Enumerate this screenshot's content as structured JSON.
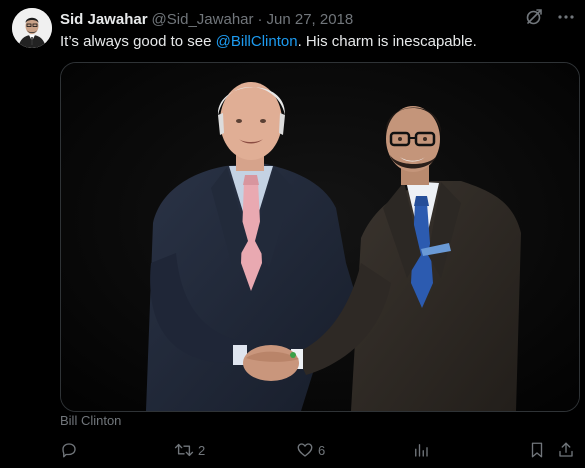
{
  "tweet": {
    "author_name": "Sid Jawahar",
    "author_handle": "@Sid_Jawahar",
    "separator": "·",
    "date": "Jun 27, 2018",
    "text_before": "It’s always good to see ",
    "mention": "@BillClinton",
    "text_after": ". His charm is inescapable.",
    "media_caption": "Bill Clinton"
  },
  "actions": {
    "replies": "",
    "retweets": "2",
    "likes": "6",
    "views": ""
  },
  "icons": {
    "reply": "reply-icon",
    "retweet": "retweet-icon",
    "like": "heart-icon",
    "analytics": "analytics-icon",
    "bookmark": "bookmark-icon",
    "share": "share-icon",
    "grok": "grok-icon",
    "more": "more-icon"
  },
  "colors": {
    "background": "#000000",
    "text": "#e7e9ea",
    "secondary": "#71767b",
    "accent": "#1d9bf0"
  }
}
